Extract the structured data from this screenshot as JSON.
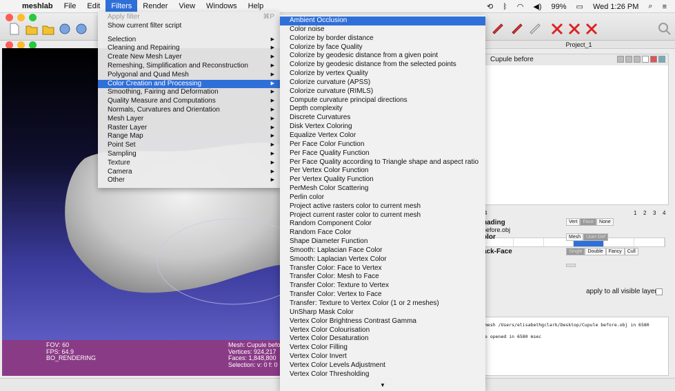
{
  "menubar": {
    "apple_icon": "apple-icon",
    "app_name": "meshlab",
    "menus": [
      "File",
      "Edit",
      "Filters",
      "Render",
      "View",
      "Windows",
      "Help"
    ],
    "active_menu": "Filters",
    "battery": "99%",
    "clock": "Wed 1:26 PM",
    "icons": [
      "time-machine-icon",
      "bluetooth-icon",
      "wifi-icon",
      "volume-icon",
      "battery-icon",
      "search-icon",
      "list-icon"
    ]
  },
  "window": {
    "project_title": "Project_1"
  },
  "filters_menu": {
    "top": [
      {
        "label": "Apply filter",
        "shortcut": "⌘P",
        "disabled": true
      },
      {
        "label": "Show current filter script",
        "disabled": false
      }
    ],
    "items": [
      {
        "label": "Selection",
        "selected": false
      },
      {
        "label": "Cleaning and Repairing",
        "selected": false
      },
      {
        "label": "Create New Mesh Layer",
        "selected": false
      },
      {
        "label": "Remeshing, Simplification and Reconstruction",
        "selected": false
      },
      {
        "label": "Polygonal and Quad Mesh",
        "selected": false
      },
      {
        "label": "Color Creation and Processing",
        "selected": true
      },
      {
        "label": "Smoothing, Fairing and Deformation",
        "selected": false
      },
      {
        "label": "Quality Measure and Computations",
        "selected": false
      },
      {
        "label": "Normals, Curvatures and Orientation",
        "selected": false
      },
      {
        "label": "Mesh Layer",
        "selected": false
      },
      {
        "label": "Raster Layer",
        "selected": false
      },
      {
        "label": "Range Map",
        "selected": false
      },
      {
        "label": "Point Set",
        "selected": false
      },
      {
        "label": "Sampling",
        "selected": false
      },
      {
        "label": "Texture",
        "selected": false
      },
      {
        "label": "Camera",
        "selected": false
      },
      {
        "label": "Other",
        "selected": false
      }
    ]
  },
  "color_submenu": {
    "items": [
      "Ambient Occlusion",
      "Color noise",
      "Colorize by border distance",
      "Colorize by face Quality",
      "Colorize by geodesic distance from a given point",
      "Colorize by geodesic distance from the selected points",
      "Colorize by vertex Quality",
      "Colorize curvature (APSS)",
      "Colorize curvature (RIMLS)",
      "Compute curvature principal directions",
      "Depth complexity",
      "Discrete Curvatures",
      "Disk Vertex Coloring",
      "Equalize Vertex Color",
      "Per Face Color Function",
      "Per Face Quality Function",
      "Per Face Quality according to Triangle shape and aspect ratio",
      "Per Vertex Color Function",
      "Per Vertex Quality Function",
      "PerMesh Color Scattering",
      "Perlin color",
      "Project active rasters color to current mesh",
      "Project current raster color to current mesh",
      "Random Component Color",
      "Random Face Color",
      "Shape Diameter Function",
      "Smooth: Laplacian Face Color",
      "Smooth: Laplacian Vertex Color",
      "Transfer Color: Face to Vertex",
      "Transfer Color: Mesh to Face",
      "Transfer Color: Texture to Vertex",
      "Transfer Color: Vertex to Face",
      "Transfer: Texture to Vertex Color (1 or 2 meshes)",
      "UnSharp Mask Color",
      "Vertex Color Brightness Contrast Gamma",
      "Vertex Color Colourisation",
      "Vertex Color Desaturation",
      "Vertex Color Filling",
      "Vertex Color Invert",
      "Vertex Color Levels Adjustment",
      "Vertex Color Thresholding"
    ],
    "highlighted_index": 0,
    "scroll_arrow": "▼"
  },
  "viewport": {
    "fov": "FOV: 60",
    "fps": "FPS:    64.9",
    "render_mode": "BO_RENDERING",
    "mesh": "Mesh: Cupule before",
    "vertices": "Vertices: 924,217",
    "faces": "Faces: 1,848,800",
    "selection": "Selection: v: 0 f: 0"
  },
  "layers": {
    "current_layer": "Cupule before",
    "pages_left": "4",
    "pages_right": [
      "1",
      "2",
      "3",
      "4"
    ],
    "object_file": "before.obj"
  },
  "render_props": {
    "shading_label": "nading",
    "shading_options": [
      "Vert",
      "Face",
      "None"
    ],
    "shading_active": "Face",
    "color_label": "olor",
    "color_options": [
      "Mesh",
      "User-Def"
    ],
    "color_active": "User-Def",
    "backface_label": "ack-Face",
    "backface_options": [
      "Single",
      "Double",
      "Fancy",
      "Cull"
    ],
    "backface_active": "Single",
    "apply_all": "apply to all visible layers"
  },
  "log": {
    "line1": "mesh /Users/elisabethgclark/Desktop/Cupule before.obj in 6580",
    "line2": "e opened in 6580 msec"
  },
  "colors": {
    "accent": "#2f6fd8",
    "info_bar": "#8a3b86",
    "viewport_bottom": "#6a6ad4"
  }
}
